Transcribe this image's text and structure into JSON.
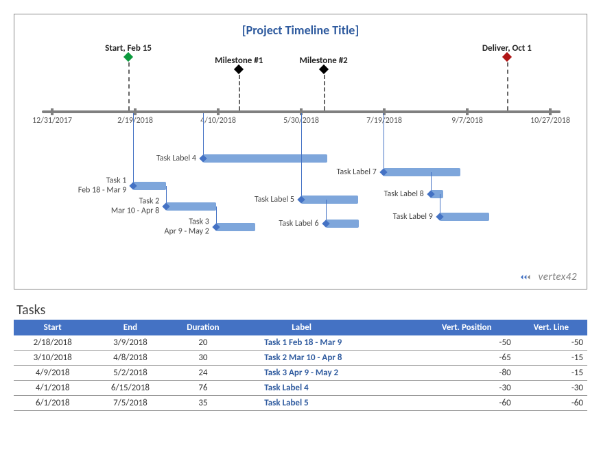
{
  "chart_title": "[Project Timeline Title]",
  "logo_text": "vertex42",
  "axis": {
    "ticks": [
      "12/31/2017",
      "2/19/2018",
      "4/10/2018",
      "5/30/2018",
      "7/19/2018",
      "9/7/2018",
      "10/27/2018"
    ]
  },
  "milestones": [
    {
      "label": "Start, Feb 15",
      "date_frac": 0.153,
      "color": "#0b9a3d",
      "label_y": 42,
      "diamond_y": 62,
      "line_top": 70
    },
    {
      "label": "Milestone #1",
      "date_frac": 0.375,
      "color": "#000000",
      "label_y": 60,
      "diamond_y": 80,
      "line_top": 88
    },
    {
      "label": "Milestone #2",
      "date_frac": 0.545,
      "color": "#000000",
      "label_y": 60,
      "diamond_y": 80,
      "line_top": 88
    },
    {
      "label": "Deliver, Oct 1",
      "date_frac": 0.913,
      "color": "#b01616",
      "label_y": 42,
      "diamond_y": 62,
      "line_top": 70
    }
  ],
  "tasks_chart": [
    {
      "label": "Task 1\nFeb 18 - Mar 9",
      "start_frac": 0.163,
      "dur_frac": 0.066,
      "y": 250,
      "line_top": 144
    },
    {
      "label": "Task 2\nMar 10 - Apr 8",
      "start_frac": 0.229,
      "dur_frac": 0.1,
      "y": 280,
      "line_top": 250
    },
    {
      "label": "Task 3\nApr 9 - May 2",
      "start_frac": 0.329,
      "dur_frac": 0.079,
      "y": 310,
      "line_top": 280
    },
    {
      "label": "Task Label 4",
      "start_frac": 0.303,
      "dur_frac": 0.25,
      "y": 210,
      "line_top": 144
    },
    {
      "label": "Task Label 5",
      "start_frac": 0.5,
      "dur_frac": 0.115,
      "y": 270,
      "line_top": 144
    },
    {
      "label": "Task Label 6",
      "start_frac": 0.549,
      "dur_frac": 0.067,
      "y": 305,
      "line_top": 270
    },
    {
      "label": "Task Label 7",
      "start_frac": 0.665,
      "dur_frac": 0.155,
      "y": 230,
      "line_top": 144
    },
    {
      "label": "Task Label 8",
      "start_frac": 0.76,
      "dur_frac": 0.025,
      "y": 262,
      "line_top": 230
    },
    {
      "label": "Task Label 9",
      "start_frac": 0.778,
      "dur_frac": 0.1,
      "y": 295,
      "line_top": 262
    }
  ],
  "table": {
    "title": "Tasks",
    "headers": [
      "Start",
      "End",
      "Duration",
      "Label",
      "Vert. Position",
      "Vert. Line"
    ],
    "rows": [
      {
        "start": "2/18/2018",
        "end": "3/9/2018",
        "duration": "20",
        "label": "Task 1  Feb 18 - Mar 9",
        "vpos": "-50",
        "vline": "-50"
      },
      {
        "start": "3/10/2018",
        "end": "4/8/2018",
        "duration": "30",
        "label": "Task 2  Mar 10 - Apr 8",
        "vpos": "-65",
        "vline": "-15"
      },
      {
        "start": "4/9/2018",
        "end": "5/2/2018",
        "duration": "24",
        "label": "Task 3  Apr 9 - May 2",
        "vpos": "-80",
        "vline": "-15"
      },
      {
        "start": "4/1/2018",
        "end": "6/15/2018",
        "duration": "76",
        "label": "Task Label 4",
        "vpos": "-30",
        "vline": "-30"
      },
      {
        "start": "6/1/2018",
        "end": "7/5/2018",
        "duration": "35",
        "label": "Task Label 5",
        "vpos": "-60",
        "vline": "-60"
      }
    ]
  },
  "chart_data": {
    "type": "bar",
    "title": "[Project Timeline Title]",
    "x_axis_dates": [
      "12/31/2017",
      "2/19/2018",
      "4/10/2018",
      "5/30/2018",
      "7/19/2018",
      "9/7/2018",
      "10/27/2018"
    ],
    "milestones": [
      {
        "name": "Start",
        "date": "2018-02-15"
      },
      {
        "name": "Milestone #1",
        "date": "2018-04-21"
      },
      {
        "name": "Milestone #2",
        "date": "2018-06-12"
      },
      {
        "name": "Deliver",
        "date": "2018-10-01"
      }
    ],
    "series": [
      {
        "name": "Task 1",
        "label": "Task 1  Feb 18 - Mar 9",
        "start": "2018-02-18",
        "end": "2018-03-09",
        "duration_days": 20,
        "vert_position": -50,
        "vert_line": -50
      },
      {
        "name": "Task 2",
        "label": "Task 2  Mar 10 - Apr 8",
        "start": "2018-03-10",
        "end": "2018-04-08",
        "duration_days": 30,
        "vert_position": -65,
        "vert_line": -15
      },
      {
        "name": "Task 3",
        "label": "Task 3  Apr 9 - May 2",
        "start": "2018-04-09",
        "end": "2018-05-02",
        "duration_days": 24,
        "vert_position": -80,
        "vert_line": -15
      },
      {
        "name": "Task 4",
        "label": "Task Label 4",
        "start": "2018-04-01",
        "end": "2018-06-15",
        "duration_days": 76,
        "vert_position": -30,
        "vert_line": -30
      },
      {
        "name": "Task 5",
        "label": "Task Label 5",
        "start": "2018-06-01",
        "end": "2018-07-05",
        "duration_days": 35,
        "vert_position": -60,
        "vert_line": -60
      },
      {
        "name": "Task 6",
        "label": "Task Label 6",
        "start": "2018-06-15",
        "end": "2018-07-05"
      },
      {
        "name": "Task 7",
        "label": "Task Label 7",
        "start": "2018-07-20",
        "end": "2018-09-05"
      },
      {
        "name": "Task 8",
        "label": "Task Label 8",
        "start": "2018-08-18",
        "end": "2018-08-25"
      },
      {
        "name": "Task 9",
        "label": "Task Label 9",
        "start": "2018-08-24",
        "end": "2018-09-23"
      }
    ]
  }
}
